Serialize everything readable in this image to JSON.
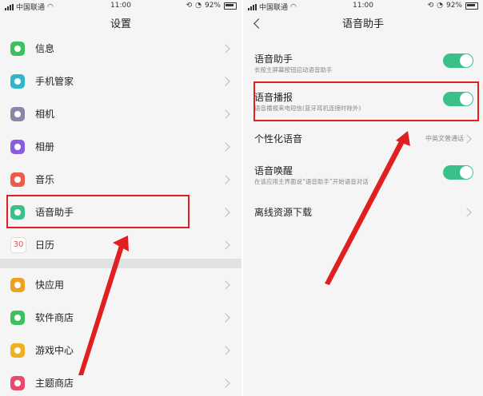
{
  "status_bar": {
    "carrier": "中国联通",
    "time": "11:00",
    "battery": "92%"
  },
  "left_screen": {
    "title": "设置",
    "items": [
      {
        "label": "信息",
        "icon": "message-icon",
        "color": "#3cc060"
      },
      {
        "label": "手机管家",
        "icon": "shield-icon",
        "color": "#2fb6c8"
      },
      {
        "label": "相机",
        "icon": "camera-icon",
        "color": "#8a86a8"
      },
      {
        "label": "相册",
        "icon": "album-icon",
        "color": "#8a5ce0"
      },
      {
        "label": "音乐",
        "icon": "music-icon",
        "color": "#f05a4a"
      },
      {
        "label": "语音助手",
        "icon": "microphone-icon",
        "color": "#3cc08a"
      },
      {
        "label": "日历",
        "icon": "calendar-icon",
        "color": "#e85050",
        "glyph": "30"
      },
      {
        "label": "快应用",
        "icon": "quick-app-icon",
        "color": "#f0a020"
      },
      {
        "label": "软件商店",
        "icon": "store-icon",
        "color": "#3cc060"
      },
      {
        "label": "游戏中心",
        "icon": "game-icon",
        "color": "#f0b020"
      },
      {
        "label": "主题商店",
        "icon": "theme-icon",
        "color": "#e84a6a"
      }
    ]
  },
  "right_screen": {
    "title": "语音助手",
    "rows": [
      {
        "title": "语音助手",
        "subtitle": "长按主屏幕按钮启动语音助手",
        "toggle": true
      },
      {
        "title": "语音播报",
        "subtitle": "语音播报来电短信(蓝牙耳机连接时除外)",
        "toggle": true
      },
      {
        "title": "个性化语音",
        "value": "中英文普通话"
      },
      {
        "title": "语音唤醒",
        "subtitle": "在该应用主界面说“语音助手”开始语音对话",
        "toggle": true
      },
      {
        "title": "离线资源下载"
      }
    ]
  },
  "colors": {
    "accent": "#3cc08a",
    "highlight": "#e02020"
  }
}
